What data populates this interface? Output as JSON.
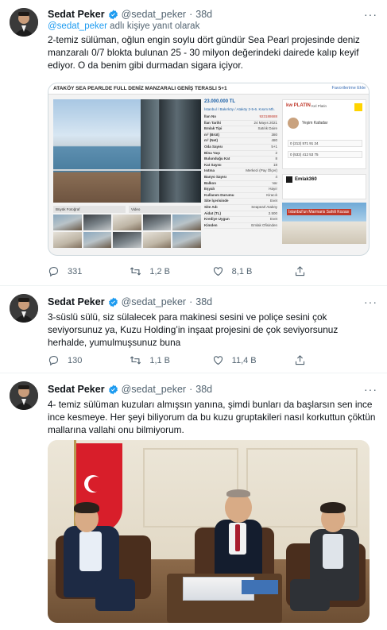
{
  "tweets": [
    {
      "name": "Sedat Peker",
      "handle": "@sedat_peker",
      "dot": "·",
      "time": "38d",
      "reply_to_handle": "@sedat_peker",
      "reply_to_suffix": " adlı kişiye yanıt olarak",
      "text": "2-temiz sülüman, oğlun engin soylu dört gündür Sea Pearl projesinde deniz manzaralı 0/7 blokta bulunan 25 - 30 milyon değerindeki dairede kalıp keyif ediyor. O da benim gibi durmadan sigara içiyor.",
      "counts": {
        "replies": "331",
        "retweets": "1,2 B",
        "likes": "8,1 B"
      }
    },
    {
      "name": "Sedat Peker",
      "handle": "@sedat_peker",
      "dot": "·",
      "time": "38d",
      "text": "3-süslü sülü, siz sülalecek para makinesi sesini ve poliçe sesini çok seviyorsunuz ya, Kuzu Holding’in inşaat projesini de çok seviyorsunuz herhalde, yumulmuşsunuz buna",
      "counts": {
        "replies": "130",
        "retweets": "1,1 B",
        "likes": "11,4 B"
      }
    },
    {
      "name": "Sedat Peker",
      "handle": "@sedat_peker",
      "dot": "·",
      "time": "38d",
      "text": "4- temiz sülüman kuzuları almışsın yanına, şimdi bunları da başlarsın sen ince ince kesmeye. Her şeyi biliyorum da bu kuzu gruptakileri nasıl korkuttun çöktün mallarına vallahi onu bilmiyorum."
    }
  ],
  "listing": {
    "header": "ATAKÖY SEA PEARLDE FULL DENİZ MANZARALI GENİŞ TERASLI 5+1",
    "header_right": "Favorilerime Ekle",
    "price": "23.000.000 TL",
    "location": "İstanbul / Bakırköy / Ataköy 2-5-6. Kısım Mh.",
    "rows": [
      {
        "k": "İlan No",
        "v": "923188688",
        "red": true
      },
      {
        "k": "İlan Tarihi",
        "v": "24 Mayıs 2021"
      },
      {
        "k": "Emlak Tipi",
        "v": "Satılık Daire"
      },
      {
        "k": "m² (Brüt)",
        "v": "380"
      },
      {
        "k": "m² (Net)",
        "v": "480"
      },
      {
        "k": "Oda Sayısı",
        "v": "5+1"
      },
      {
        "k": "Bina Yaşı",
        "v": "2"
      },
      {
        "k": "Bulunduğu Kat",
        "v": "8"
      },
      {
        "k": "Kat Sayısı",
        "v": "18"
      },
      {
        "k": "Isıtma",
        "v": "Merkezi (Pay Ölçer)"
      },
      {
        "k": "Banyo Sayısı",
        "v": "4"
      },
      {
        "k": "Balkon",
        "v": "Var"
      },
      {
        "k": "Eşyalı",
        "v": "Hayır"
      },
      {
        "k": "Kullanım Durumu",
        "v": "Kiracılı"
      },
      {
        "k": "Site İçerisinde",
        "v": "Evet"
      },
      {
        "k": "Site Adı",
        "v": "Seapearl Ataköy"
      },
      {
        "k": "Aidat (TL)",
        "v": "2.500"
      },
      {
        "k": "Krediye Uygun",
        "v": "Evet"
      },
      {
        "k": "Kimden",
        "v": "Emlak Ofisinden"
      }
    ],
    "agency_logo": "kw PLATIN",
    "agency_sub": "Kel Platin",
    "agent_name": "Yeşim Kafadar",
    "phone1": "0 (212) 571 91 24",
    "phone2": "0 (532) 412 53 75",
    "emlak_brand": "Emlak360",
    "ad_tag": "İstanbul'un Marmaris Sahili Kozası",
    "tab_photo": "Büyük Fotoğraf",
    "tab_video": "Video"
  }
}
